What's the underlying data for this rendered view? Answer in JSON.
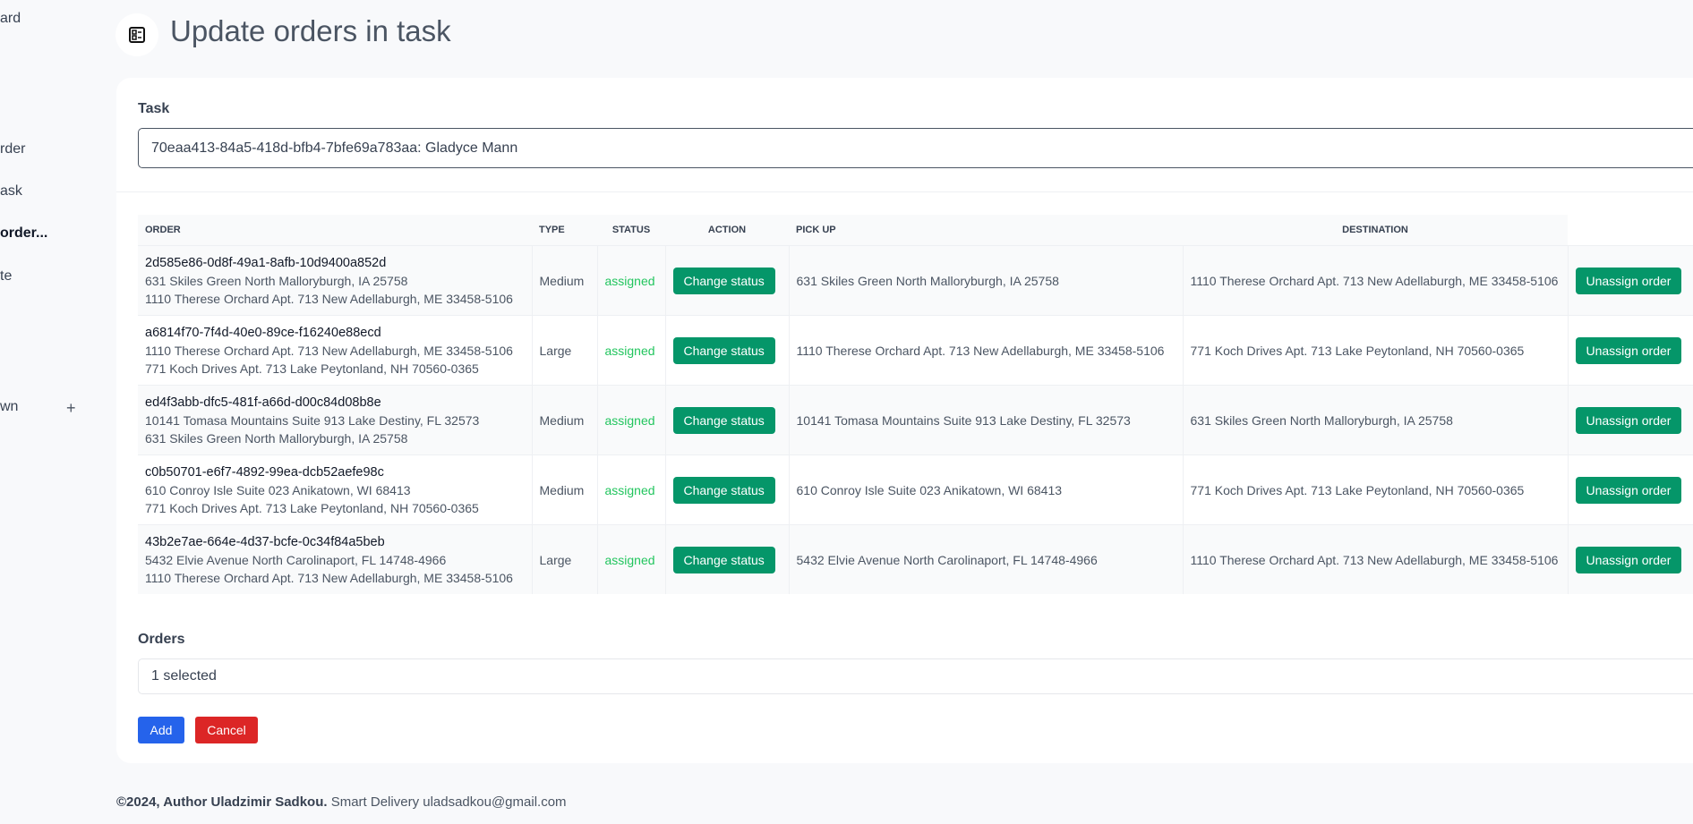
{
  "sidebar": {
    "items": [
      {
        "label": "ard"
      },
      {
        "label": "rder"
      },
      {
        "label": "ask"
      },
      {
        "label": "order..."
      },
      {
        "label": "te"
      },
      {
        "label": "wn"
      }
    ],
    "plus_icon": "plus-icon"
  },
  "header": {
    "title": "Update orders in task",
    "icon": "list-icon"
  },
  "task": {
    "label": "Task",
    "value": "70eaa413-84a5-418d-bfb4-7bfe69a783aa: Gladyce Mann"
  },
  "table": {
    "columns": [
      "ORDER",
      "TYPE",
      "STATUS",
      "ACTION",
      "PICK UP",
      "DESTINATION"
    ],
    "rows": [
      {
        "id": "2d585e86-0d8f-49a1-8afb-10d9400a852d",
        "from": "631 Skiles Green North Malloryburgh, IA 25758",
        "to": "1110 Therese Orchard Apt. 713 New Adellaburgh, ME 33458-5106",
        "type": "Medium",
        "status": "assigned",
        "action": "Change status",
        "pickup": "631 Skiles Green North Malloryburgh, IA 25758",
        "destination": "1110 Therese Orchard Apt. 713 New Adellaburgh, ME 33458-5106",
        "unassign": "Unassign order"
      },
      {
        "id": "a6814f70-7f4d-40e0-89ce-f16240e88ecd",
        "from": "1110 Therese Orchard Apt. 713 New Adellaburgh, ME 33458-5106",
        "to": "771 Koch Drives Apt. 713 Lake Peytonland, NH 70560-0365",
        "type": "Large",
        "status": "assigned",
        "action": "Change status",
        "pickup": "1110 Therese Orchard Apt. 713 New Adellaburgh, ME 33458-5106",
        "destination": "771 Koch Drives Apt. 713 Lake Peytonland, NH 70560-0365",
        "unassign": "Unassign order"
      },
      {
        "id": "ed4f3abb-dfc5-481f-a66d-d00c84d08b8e",
        "from": "10141 Tomasa Mountains Suite 913 Lake Destiny, FL 32573",
        "to": "631 Skiles Green North Malloryburgh, IA 25758",
        "type": "Medium",
        "status": "assigned",
        "action": "Change status",
        "pickup": "10141 Tomasa Mountains Suite 913 Lake Destiny, FL 32573",
        "destination": "631 Skiles Green North Malloryburgh, IA 25758",
        "unassign": "Unassign order"
      },
      {
        "id": "c0b50701-e6f7-4892-99ea-dcb52aefe98c",
        "from": "610 Conroy Isle Suite 023 Anikatown, WI 68413",
        "to": "771 Koch Drives Apt. 713 Lake Peytonland, NH 70560-0365",
        "type": "Medium",
        "status": "assigned",
        "action": "Change status",
        "pickup": "610 Conroy Isle Suite 023 Anikatown, WI 68413",
        "destination": "771 Koch Drives Apt. 713 Lake Peytonland, NH 70560-0365",
        "unassign": "Unassign order"
      },
      {
        "id": "43b2e7ae-664e-4d37-bcfe-0c34f84a5beb",
        "from": "5432 Elvie Avenue North Carolinaport, FL 14748-4966",
        "to": "1110 Therese Orchard Apt. 713 New Adellaburgh, ME 33458-5106",
        "type": "Large",
        "status": "assigned",
        "action": "Change status",
        "pickup": "5432 Elvie Avenue North Carolinaport, FL 14748-4966",
        "destination": "1110 Therese Orchard Apt. 713 New Adellaburgh, ME 33458-5106",
        "unassign": "Unassign order"
      }
    ]
  },
  "orders": {
    "label": "Orders",
    "value": "1 selected"
  },
  "buttons": {
    "add": "Add",
    "cancel": "Cancel"
  },
  "footer": {
    "bold": "©2024, Author Uladzimir Sadkou.",
    "text": " Smart Delivery uladsadkou@gmail.com"
  },
  "colors": {
    "green": "#059669",
    "status_green": "#22c55e",
    "add_blue": "#2563eb",
    "cancel_red": "#dc2626"
  }
}
